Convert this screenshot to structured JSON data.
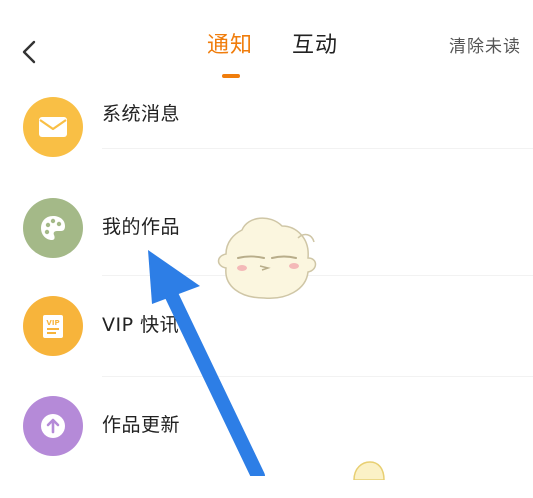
{
  "header": {
    "tabs": [
      {
        "label": "通知",
        "active": true
      },
      {
        "label": "互动",
        "active": false
      }
    ],
    "clear_label": "清除未读",
    "accent_color": "#f07d0c"
  },
  "list": [
    {
      "label": "系统消息",
      "icon": "envelope-icon",
      "color": "#f9bf45"
    },
    {
      "label": "我的作品",
      "icon": "palette-icon",
      "color": "#a4b988"
    },
    {
      "label": "VIP 快讯",
      "icon": "vip-card-icon",
      "color": "#f7b43b"
    },
    {
      "label": "作品更新",
      "icon": "upload-arrow-icon",
      "color": "#b58ad8"
    }
  ],
  "overlay": {
    "pointer_color": "#2d7ee6"
  }
}
